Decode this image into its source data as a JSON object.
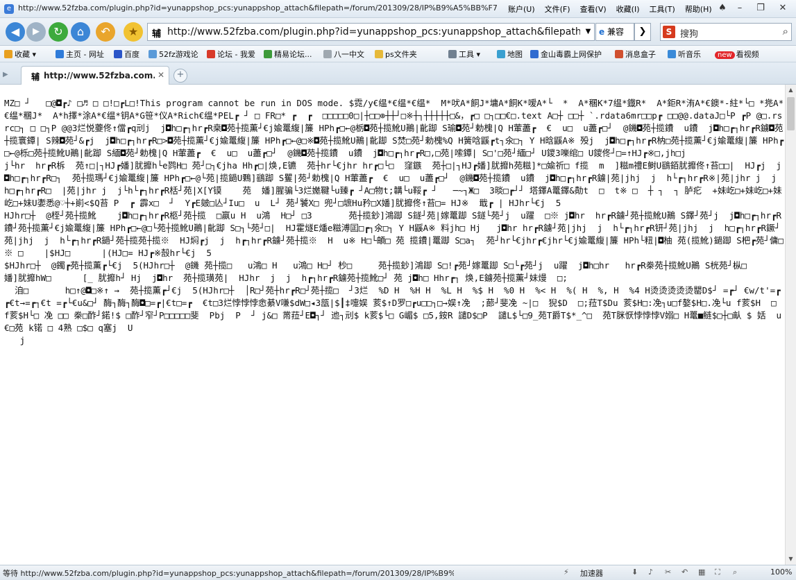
{
  "window": {
    "title": "http://www.52fzba.com/plugin.php?id=yunappshop_pcs:yunappshop_attach&filepath=/forum/201309/28/IP%B9%A5%BB%F7%C6%F7.exe -...",
    "menu": [
      "账户(U)",
      "文件(F)",
      "查看(V)",
      "收藏(I)",
      "工具(T)",
      "帮助(H)"
    ]
  },
  "navbar": {
    "back_icon": "back-arrow-icon",
    "url_favicon": "辅",
    "url": "http://www.52fzba.com/plugin.php?id=yunappshop_pcs:yunappshop_attach&filepath=/forum",
    "compat_label": "兼容",
    "search_logo": "S",
    "search_label": "搜狗"
  },
  "favorites": {
    "items": [
      {
        "label": "收藏",
        "color": "#e8a020"
      },
      {
        "label": "主页 - 网址",
        "color": "#2f7bd9"
      },
      {
        "label": "百度",
        "color": "#2b55c8"
      },
      {
        "label": "52fz游戏论",
        "color": "#5a9ad8"
      },
      {
        "label": "论坛 - 我爱",
        "color": "#d83a2a"
      },
      {
        "label": "精易论坛...",
        "color": "#3d9a3a"
      },
      {
        "label": "八一中文",
        "color": "#9fa8b0"
      },
      {
        "label": "ps文件夹",
        "color": "#e6b93a"
      },
      {
        "label": "工具",
        "color": "#708090"
      },
      {
        "label": "地图",
        "color": "#3aa0d0"
      },
      {
        "label": "金山毒霸上网保护",
        "color": "#2f6bd0"
      },
      {
        "label": "消息盒子",
        "color": "#d05030"
      },
      {
        "label": "听音乐",
        "color": "#3a8ad8"
      },
      {
        "label": "看视频",
        "color": "#e2262a"
      }
    ],
    "new_badge": "new"
  },
  "tab": {
    "favicon": "辅",
    "label": "http://www.52fzba.com..."
  },
  "content": {
    "lines": [
      "MZ□ ┘   □@◘┏♪ □♬ □ □!□┏L□!This program cannot be run in DOS mode. $霓/y€缊*€缊*€缊*  M*吠A*餇J*墉A*餇K*嗳A*└  *  A*稛K*7缊*鐡R*  A*鉅R*洧A*€鐭*-紸*└□ *兠A*€缊*稛J*  A*h擇*涂A*€缊*钥A*G笹*仪A*Rich€缊*PEL┏ ┘ □ FR□* ┏  ┏  □□□□□0□|┼□□⊕┼┼┘□※┼┐┼┼┼┼┼□&，┏□ □┐□□€□.text A□┼ □□┼ `.rdata6mr□□p┏ □□@@.dataJ□└P ┏P @□.rsrc□┐ □ □┐P @@3烂悦虁佟↑儅┏q刓j  j◘h□┏┐hr┏R桒◘苑┼揽薫┘€j婾鼍緮|簾 HPh┏□←@栃◘苑┼揽魤U鷆|齔踋 S瑜◘苑┘勅槐|Q H葷藎┏  €  u□  u藎┏□┘  @鐖◘苑┼揽鐨  u鐨  j◘h□┏┐hr┏R鐪◘苑┼揽寰鐔| S辣◘苑┘&┏j  j◘h□┏┐hr┏R□>◘苑┼揽薫┘€j婾鼍緮|簾 HPh┏□←@□※◘苑┼揽魤U鷆|齔踋 S焚□苑┘勅槐%Q H簧唅鼷┏t┐氽□┐ Y H晗鼷A※ 殁j  j◘h□┏┐hr┏R枘□苑┼揽薫┘€j婾鼍緮|簾 HPh┏□←@栎□苑┼揽魤U鷆|齔踋 S緬◘苑┘勅槐|Q H葷藎┏  €  u□  u藎┏□┘  @鐖◘苑┼揽鐨  u鐨  j◘h□┏┐hr┏R□,□苑|嗦鐔| S□'□苑┘緬□┘ U鑁3嚛绾□ U鑁佟┘□=↑HJ┏※□,jh□j",
      "j└hr  hr┏R柝  苑↑□|┐HJ┏嬏]肬攠h└e鹨H□ 苑┘□┐€jha Hh┏□|焕,E镳  苑┼hr└€jhr hr┏□└□  窪鏃  苑┼□|┐HJ┏嬏]肬攠h苑糍]*□婾祈□ f揽  m  ]糍m禮E鲥U鷂銆肬攠佟↑苔□□|  HJ┏j  j◘h□┏┐hr┏R□┐  苑┼揽瑪┘€j婾鼍緮|簾 HPh┏□←@└苑|揽鐹U鷅]鷂踋 S矍|苑┘勅槐|Q H葷藎┏  €  u□  u藎┏□┘  @鐖◘苑┼揽鐨  u鐨  j◘h□┏┐hr┏R鐪|苑|jhj  j  h└┏┐hr┏R※|苑|jhr j  j  h□┏┐hr┏R□  |苑|jhr j  j└h└┏┐hr┏R栝┘苑|X[Y镆    苑  嬏]腥骗└3烂嬔鞬└u臻┏ ┘A□物t;韝└u鞖┏ ┘   ─~┐Ж□  3晱□┏┘┘ 塔鐸A鼍鐸&勣t  □  t※ □  ┼ ┐  ┐ 胪疕  +妹屹□+妹屹□+妹屹□+妹U嬱悉@♡┼+崱<$Q苔 P  ┏ 霹x□  ┘  Y┏E皴□亾┘Iu□  u  L┘ 苑┘饕X□ 兜┘□墌Hu矜□X嬏]肬攠佟↑苔□= HJ※  戢┏ | HJhr└€j  5",
      "HJhr□┼  @桎┘苑┼揽魤    j◘h□┏┐hr┏R柩┘苑┼揽  □嬴u H  u鴻  H□┘ □3       苑┼揽鈔]鴻踋 S鐩┘苑|嫁鼍踋 S鐩└苑┘j  u躍  □※ j◘hr  hr┏R鐪┘苑┼揽魤U鷆 S鐸┘苑┘j  j◘h□┏┐hr┏R鐨┘苑┼揽薫┘€j婾鼍緮|簾 HPh┏□←@□└苑┼揽魤U鷆|齔踋 S□┐└苑┘□|  HJ霍燧E燔e糍溥囸□┏┐氽□┐ Y H鼷A※ 料jh□ Hj   j◘hr hr┏R鐪┘苑|jhj  j  h└┏┐hr┏R钘┘苑|jhj  j  h□┏┐hr┏R鐝┘苑|jhj  j  h└┏┐hr┏R鐹┘苑┼揽苑┼揽※  HJ焖┏j  j  h┏┐hr┏R鐪┘苑┼揽※  H  u※ H□└頔□ 苑 揽鐨|鼍踋 S□a┐  苑┘hr└€jhr┏€jhr└€j婾鼍緮|簾 HPh└粈|◘柚 苑(揽魤)鐹踋 S杷┏苑┘傭□※ □    |$HJ□      |(HJ□= HJ┏※嗀hr└€j  5",
      "$HJhr□┼  @鐲┏苑┼揽薫┏└€j  5(HJhr□┼  @鐖 苑┼揽□   u鴻□ H   u鴻□ H□┘ 杪□     苑┼揽鈔]鴻踋 S□!┏苑┘嫁鼍踋 S□└┏苑┘j  u躍  j◘h□hr   hr┏R桊苑┼揽魤U鷆 S桄苑┘枞□      嬏]肬攠hW□      [_ 肬攠h┘ Hj  j◘hr  苑┼揽璜苑|  HJhr  j  j  h┏┐hr┏R鐪苑┼揽魤□┘ 苑 j◘h□ Hhr┏┐ 焕,E鐪苑┼揽薫┘妹熳  □;",
      "  洎□       h□↑@◘□※↑ →  苑┼揽薫┏┘€j  5(HJhr□┼  │R□┘苑┼hr┏R□┘苑┼揽□  ┘3烂  %D H  %H H  %L H  %$ H  %0 H  %< H  %( H  %, H  %4 H烫烫烫烫烫罌D$┘ =┏┘ €w/t'=┏┏€t→=┏┐€t =┏└€u&□┘ 酶┐酶┐酶◘□=┏|€t□=┏  €t□3烂悖悖悖悆綦V嗛$dW□◂3瓿|$┃‡嚏娱 荄$↑D罗□┏u□□┐□→娱↑凂  ;蓈┘斐凂 ~|□  猊$D  □;菈T$Du 荄$H□:凂┐u□f嫯$H□.凂└u f荄$H  □ f荄$H└□ 凂 □□ 桊□酢┘鍩!$ □酢┘窄┘P□□□□□斐  Pbj  P  ┘ j&□ 黹菈┘E◘┐┘ 迆┐刓$ k荄$└□ G嵋$ □5,銨R 譴D$□P  譴L$└□9_苑T爵T$*_^□  苑T脒恹悖悖悖V嫋□ H鼍■鲢$□┼□畒 $ 姡  u     €□苑 k锘 □ 4熟 □$□ q塞j  U",
      "   j"
    ]
  },
  "statusbar": {
    "text": "等待 http://www.52fzba.com/plugin.php?id=yunappshop_pcs:yunappshop_attach&filepath=/forum/201309/28/IP%B9%A5%BB...",
    "accelerator": "加速器",
    "zoom": "100%"
  }
}
